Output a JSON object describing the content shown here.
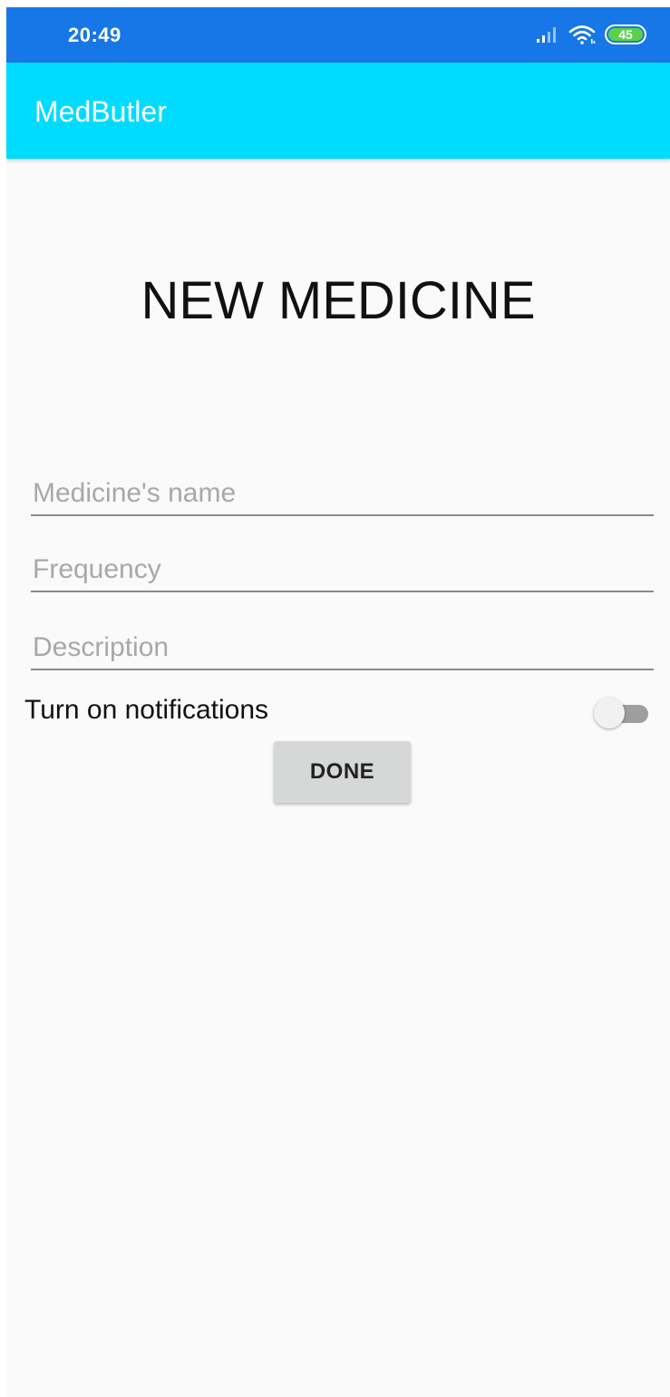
{
  "status_bar": {
    "time": "20:49",
    "battery_level": "45",
    "battery_color": "#5bd24a",
    "icons": [
      "signal-icon",
      "wifi-icon",
      "battery-icon"
    ]
  },
  "app_bar": {
    "title": "MedButler",
    "color": "#00dcff"
  },
  "page": {
    "title": "NEW MEDICINE"
  },
  "form": {
    "name_placeholder": "Medicine's name",
    "frequency_placeholder": "Frequency",
    "description_placeholder": "Description",
    "notifications_label": "Turn on notifications",
    "notifications_on": false,
    "done_label": "DONE"
  }
}
